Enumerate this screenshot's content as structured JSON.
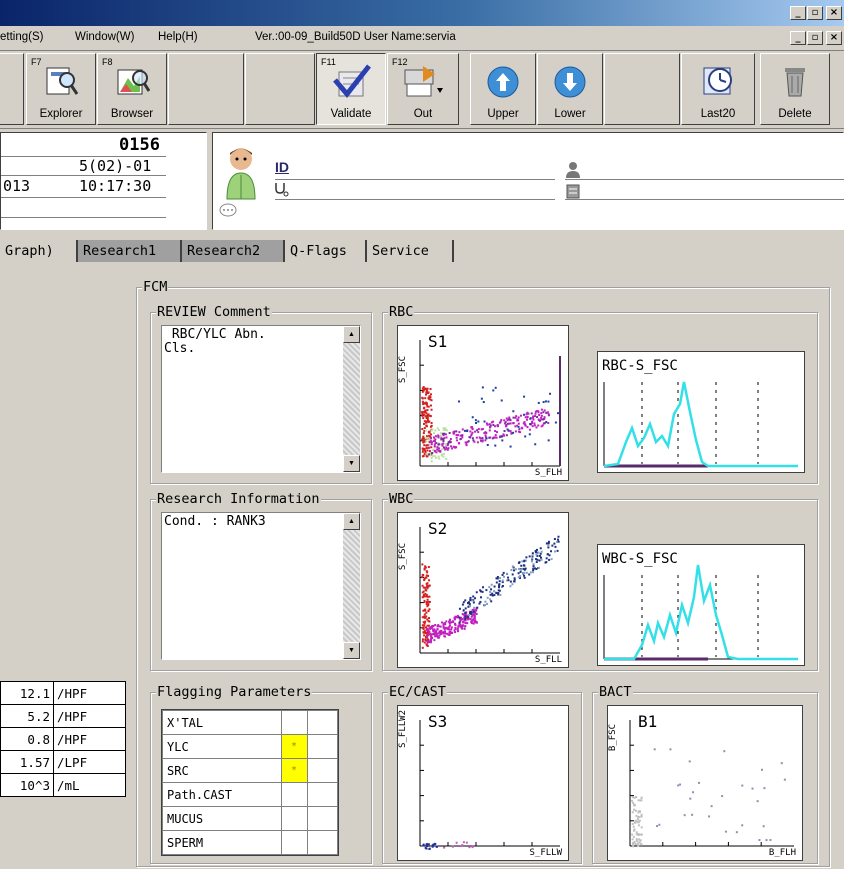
{
  "menu": {
    "setting": "etting(S)",
    "window": "Window(W)",
    "help": "Help(H)",
    "version": "Ver.:00-09_Build50D User Name:servia"
  },
  "toolbar": {
    "explorer": {
      "fkey": "F7",
      "label": "Explorer"
    },
    "browser": {
      "fkey": "F8",
      "label": "Browser"
    },
    "validate": {
      "fkey": "F11",
      "label": "Validate"
    },
    "out": {
      "fkey": "F12",
      "label": "Out"
    },
    "upper": {
      "label": "Upper"
    },
    "lower": {
      "label": "Lower"
    },
    "last20": {
      "label": "Last20"
    },
    "delete": {
      "label": "Delete"
    }
  },
  "sample": {
    "number": "0156",
    "rack": "5(02)-01",
    "date": "013",
    "time": "10:17:30"
  },
  "patient": {
    "id_label": "ID"
  },
  "tabs": [
    {
      "label": "Graph)",
      "selected": false
    },
    {
      "label": "Research1",
      "selected": true
    },
    {
      "label": "Research2",
      "selected": true
    },
    {
      "label": "Q-Flags",
      "selected": false
    },
    {
      "label": "Service",
      "selected": false
    }
  ],
  "fcm": {
    "title": "FCM",
    "review": {
      "title": "REVIEW Comment",
      "text": " RBC/YLC Abn.\nCls."
    },
    "research": {
      "title": "Research Information",
      "text": "Cond. : RANK3"
    },
    "flagging": {
      "title": "Flagging Parameters",
      "rows": [
        {
          "name": "X'TAL",
          "flag": ""
        },
        {
          "name": "YLC",
          "flag": "*"
        },
        {
          "name": "SRC",
          "flag": "*"
        },
        {
          "name": "Path.CAST",
          "flag": ""
        },
        {
          "name": "MUCUS",
          "flag": ""
        },
        {
          "name": "SPERM",
          "flag": ""
        }
      ]
    },
    "rbc": {
      "title": "RBC",
      "scatter": "S1",
      "ylabel": "S_FSC",
      "xlabel": "S_FLH",
      "hist": "RBC-S_FSC"
    },
    "wbc": {
      "title": "WBC",
      "scatter": "S2",
      "ylabel": "S_FSC",
      "xlabel": "S_FLL",
      "hist": "WBC-S_FSC"
    },
    "ec": {
      "title": "EC/CAST",
      "scatter": "S3",
      "ylabel": "S_FLLW2",
      "xlabel": "S_FLLW"
    },
    "bact": {
      "title": "BACT",
      "scatter": "B1",
      "ylabel": "B_FSC",
      "xlabel": "B_FLH"
    }
  },
  "results": [
    {
      "value": "12.1",
      "unit": "/HPF"
    },
    {
      "value": "5.2",
      "unit": "/HPF"
    },
    {
      "value": "0.8",
      "unit": "/HPF"
    },
    {
      "value": "1.57",
      "unit": "/LPF"
    },
    {
      "value": "10^3",
      "unit": "/mL"
    }
  ],
  "colors": {
    "flag_yellow": "#ffff00",
    "hist_cyan": "#33e0e8",
    "axis_purple": "#5a2a6a"
  }
}
